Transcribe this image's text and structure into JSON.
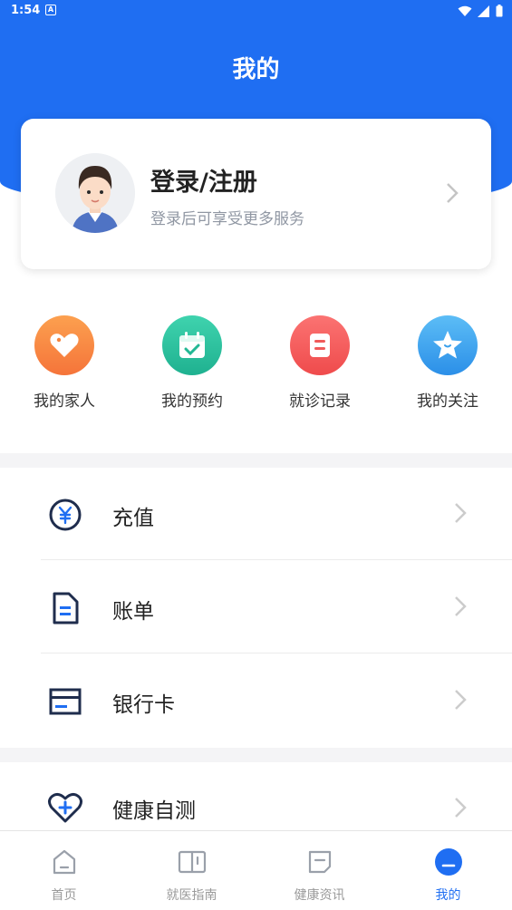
{
  "status_bar": {
    "time": "1:54",
    "notification_glyph": "A"
  },
  "header": {
    "title": "我的"
  },
  "profile": {
    "title": "登录/注册",
    "subtitle": "登录后可享受更多服务"
  },
  "quick_actions": [
    {
      "label": "我的家人",
      "icon": "heart-tag-icon",
      "color": "#fa8a3e"
    },
    {
      "label": "我的预约",
      "icon": "calendar-check-icon",
      "color": "#2cc3a0"
    },
    {
      "label": "就诊记录",
      "icon": "record-icon",
      "color": "#f5595a"
    },
    {
      "label": "我的关注",
      "icon": "star-icon",
      "color": "#3aa4f0"
    }
  ],
  "menu": [
    {
      "label": "充值",
      "icon": "yen-circle-icon"
    },
    {
      "label": "账单",
      "icon": "bill-icon"
    },
    {
      "label": "银行卡",
      "icon": "bank-card-icon"
    },
    {
      "label": "健康自测",
      "icon": "heart-plus-icon"
    }
  ],
  "tabs": [
    {
      "label": "首页",
      "icon": "home-icon",
      "active": false
    },
    {
      "label": "就医指南",
      "icon": "book-icon",
      "active": false
    },
    {
      "label": "健康资讯",
      "icon": "news-icon",
      "active": false
    },
    {
      "label": "我的",
      "icon": "profile-icon",
      "active": true
    }
  ],
  "colors": {
    "primary": "#1f6ef2",
    "background": "#f4f4f6",
    "icon_navy": "#1f2d4d"
  }
}
